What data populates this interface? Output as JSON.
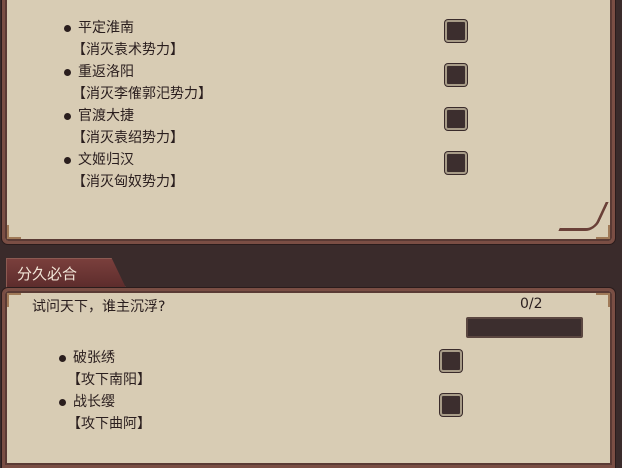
{
  "top_section": {
    "tasks": [
      {
        "name": "平定淮南",
        "sub": "【消灭袁术势力】"
      },
      {
        "name": "重返洛阳",
        "sub": "【消灭李傕郭汜势力】"
      },
      {
        "name": "官渡大捷",
        "sub": "【消灭袁绍势力】"
      },
      {
        "name": "文姬归汉",
        "sub": "【消灭匈奴势力】"
      }
    ]
  },
  "bottom_section": {
    "tab_label": "分久必合",
    "quest_title": "试问天下，谁主沉浮?",
    "progress_text": "0/2",
    "progress_fraction": 0,
    "tasks": [
      {
        "name": "破张绣",
        "sub": "【攻下南阳】"
      },
      {
        "name": "战长缨",
        "sub": "【攻下曲阿】"
      }
    ]
  }
}
